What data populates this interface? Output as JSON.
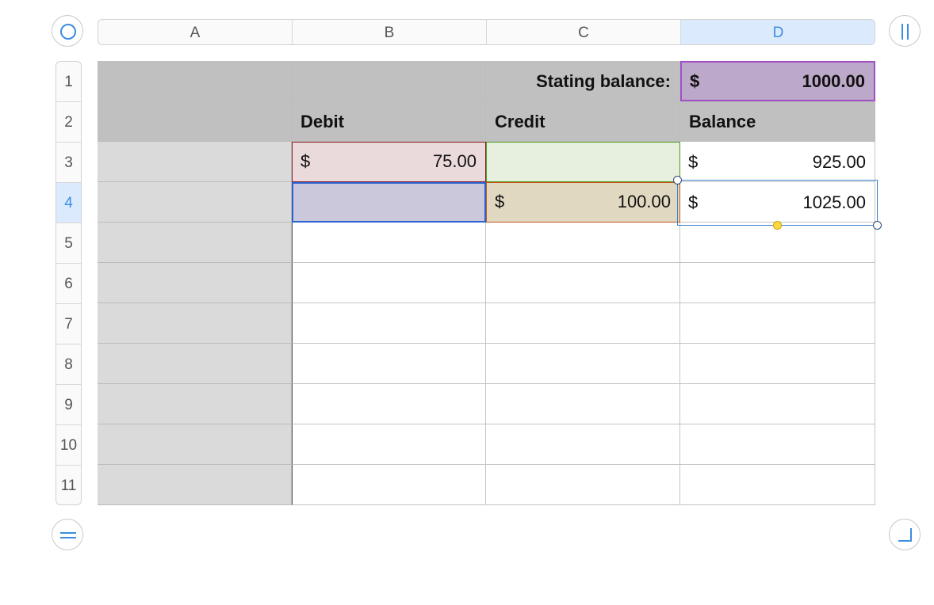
{
  "columns": [
    "A",
    "B",
    "C",
    "D"
  ],
  "rows": [
    "1",
    "2",
    "3",
    "4",
    "5",
    "6",
    "7",
    "8",
    "9",
    "10",
    "11"
  ],
  "selected_column": "D",
  "selected_row": "4",
  "cells": {
    "C1": "Stating balance:",
    "D1_currency": "$",
    "D1_value": "1000.00",
    "B2": "Debit",
    "C2": "Credit",
    "D2": "Balance",
    "B3_currency": "$",
    "B3_value": "75.00",
    "D3_currency": "$",
    "D3_value": "925.00",
    "C4_currency": "$",
    "C4_value": "100.00",
    "D4_currency": "$",
    "D4_value": "1025.00"
  },
  "highlights": {
    "D1": "#bca8c8",
    "B3": "#ebdadb",
    "C3": "#e7f0de",
    "B4": "#cbc8dc",
    "C4": "#e0d8c0"
  },
  "accent_color": "#3b8de0",
  "icons": {
    "top_left": "circle-icon",
    "top_right": "pause-bars-icon",
    "bottom_left": "equal-bars-icon",
    "bottom_right": "corner-resize-icon"
  }
}
